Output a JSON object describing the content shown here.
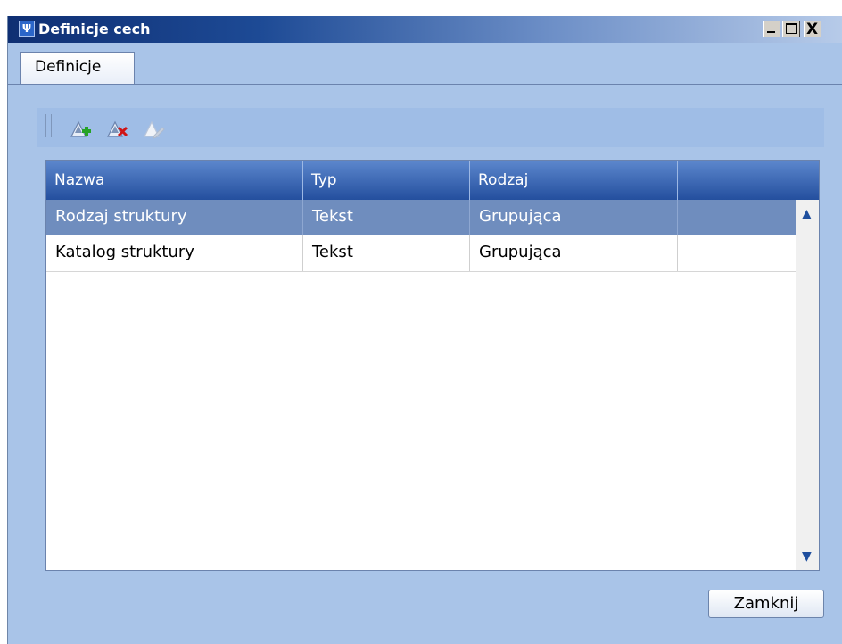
{
  "window": {
    "title": "Definicje cech",
    "app_icon_glyph": "Ψ",
    "buttons": {
      "close_glyph": "X"
    }
  },
  "tabs": [
    {
      "label": "Definicje",
      "active": true
    }
  ],
  "toolbar": {
    "buttons": [
      {
        "name": "add-feature",
        "icon": "add-green-plus-icon"
      },
      {
        "name": "delete-feature",
        "icon": "delete-red-x-icon"
      },
      {
        "name": "edit-feature",
        "icon": "edit-pencil-icon-disabled"
      }
    ]
  },
  "grid": {
    "columns": [
      "Nazwa",
      "Typ",
      "Rodzaj",
      ""
    ],
    "rows": [
      {
        "nazwa": "Rodzaj struktury",
        "typ": "Tekst",
        "rodzaj": "Grupująca",
        "selected": true
      },
      {
        "nazwa": "Katalog struktury",
        "typ": "Tekst",
        "rodzaj": "Grupująca",
        "selected": false
      }
    ],
    "scroll": {
      "up": "▲",
      "down": "▼"
    }
  },
  "footer": {
    "close_label": "Zamknij"
  },
  "colors": {
    "accent": "#244f9e",
    "panel": "#a9c4e8",
    "selected_row": "#6f8dbe"
  }
}
